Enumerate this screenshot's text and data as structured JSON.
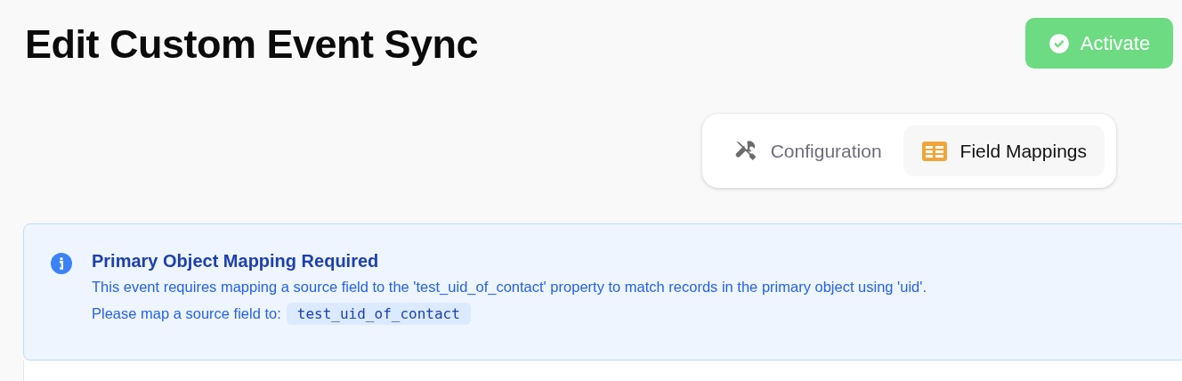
{
  "page": {
    "title": "Edit Custom Event Sync"
  },
  "activate_button": {
    "label": "Activate"
  },
  "tabs": [
    {
      "label": "Configuration",
      "kind": "tools",
      "selected": false
    },
    {
      "label": "Field Mappings",
      "kind": "table",
      "selected": true
    }
  ],
  "alert": {
    "title": "Primary Object Mapping Required",
    "message": "This event requires mapping a source field to the 'test_uid_of_contact' property to match records in the primary object using 'uid'.",
    "prompt": "Please map a source field to:",
    "code": "test_uid_of_contact"
  }
}
